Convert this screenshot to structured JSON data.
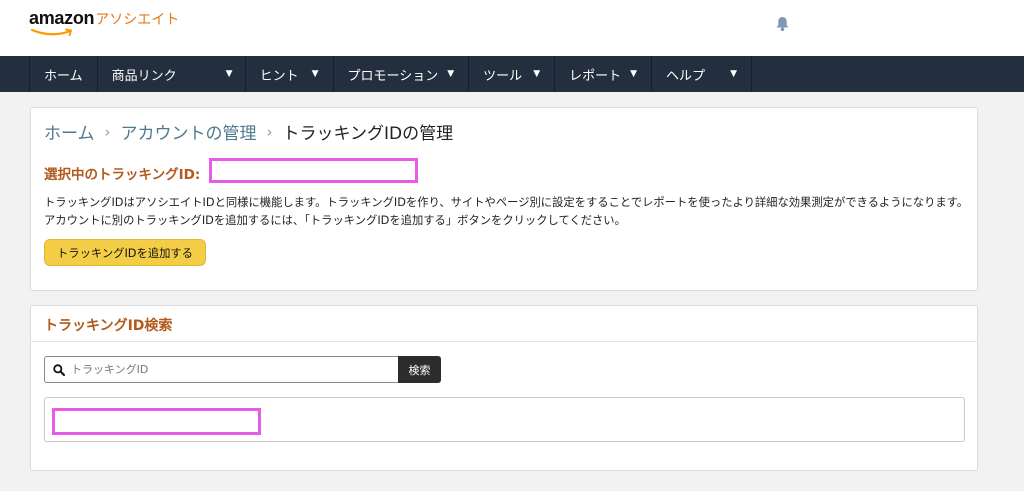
{
  "header": {
    "logo_word": "amazon",
    "logo_suffix": "アソシエイト",
    "bell_icon": "bell-icon"
  },
  "nav": {
    "items": [
      {
        "label": "ホーム",
        "dropdown": false
      },
      {
        "label": "商品リンク",
        "dropdown": true
      },
      {
        "label": "ヒント",
        "dropdown": true
      },
      {
        "label": "プロモーション",
        "dropdown": true
      },
      {
        "label": "ツール",
        "dropdown": true
      },
      {
        "label": "レポート",
        "dropdown": true
      },
      {
        "label": "ヘルプ",
        "dropdown": true
      }
    ],
    "caret": "▼"
  },
  "breadcrumb": {
    "home": "ホーム",
    "account": "アカウントの管理",
    "current": "トラッキングIDの管理",
    "separator": "›"
  },
  "tracking": {
    "selected_label": "選択中のトラッキングID:",
    "description": "トラッキングIDはアソシエイトIDと同様に機能します。トラッキングIDを作り、サイトやページ別に設定をすることでレポートを使ったより詳細な効果測定ができるようになります。アカウントに別のトラッキングIDを追加するには、「トラッキングIDを追加する」ボタンをクリックしてください。",
    "add_button": "トラッキングIDを追加する"
  },
  "search": {
    "title": "トラッキングID検索",
    "placeholder": "トラッキングID",
    "button": "検索"
  },
  "colors": {
    "nav_bg": "#232f3e",
    "accent_orange": "#b15a1e",
    "button_yellow": "#f4cd46",
    "highlight_magenta": "#e55ce6"
  }
}
